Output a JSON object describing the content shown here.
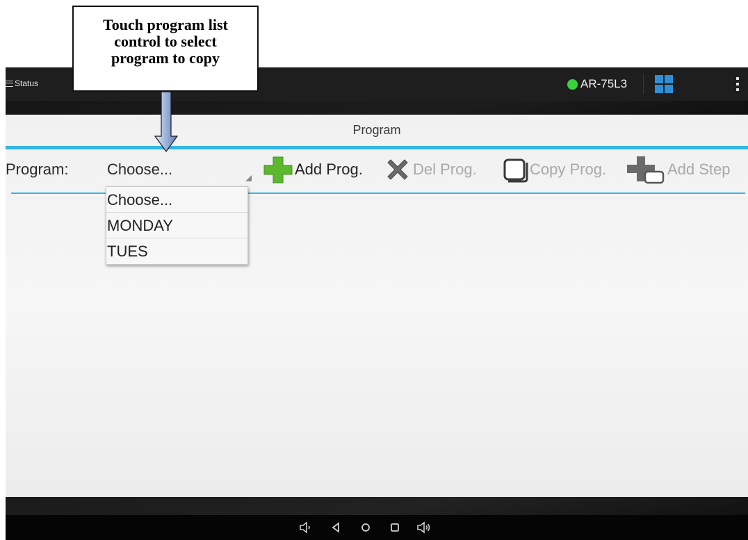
{
  "callout": {
    "line1": "Touch program list",
    "line2": "control to select",
    "line3": "program to copy"
  },
  "action_bar": {
    "menu_label": "Status",
    "device_name": "AR-75L3",
    "status_color": "#3bd33b",
    "icons": [
      "hamburger-icon",
      "status-dot-icon",
      "tiles-icon",
      "overflow-menu-icon"
    ]
  },
  "page": {
    "title": "Program",
    "accent_color": "#33b5e5"
  },
  "program_row": {
    "label": "Program:",
    "selected": "Choose...",
    "buttons": [
      {
        "label": "Add Prog.",
        "icon": "plus-icon",
        "enabled": true
      },
      {
        "label": "Del Prog.",
        "icon": "x-icon",
        "enabled": false
      },
      {
        "label": "Copy Prog.",
        "icon": "copy-icon",
        "enabled": false
      },
      {
        "label": "Add Step",
        "icon": "add-step-icon",
        "enabled": false
      }
    ]
  },
  "dropdown": {
    "options": [
      "Choose...",
      "MONDAY",
      "TUES"
    ]
  },
  "nav_bar": {
    "icons": [
      "volume-down-icon",
      "back-icon",
      "home-icon",
      "recents-icon",
      "volume-up-icon"
    ]
  }
}
